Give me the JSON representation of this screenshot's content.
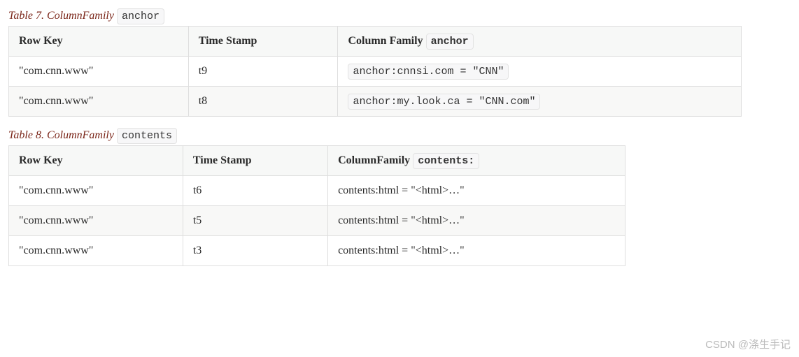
{
  "table7": {
    "caption_prefix": "Table 7. ColumnFamily ",
    "caption_code": "anchor",
    "headers": {
      "col1": "Row Key",
      "col2": "Time Stamp",
      "col3_prefix": "Column Family ",
      "col3_code": "anchor"
    },
    "rows": [
      {
        "rowkey": "\"com.cnn.www\"",
        "ts": "t9",
        "cf_code": "anchor:cnnsi.com = \"CNN\""
      },
      {
        "rowkey": "\"com.cnn.www\"",
        "ts": "t8",
        "cf_code": "anchor:my.look.ca = \"CNN.com\""
      }
    ]
  },
  "table8": {
    "caption_prefix": "Table 8. ColumnFamily ",
    "caption_code": "contents",
    "headers": {
      "col1": "Row Key",
      "col2": "Time Stamp",
      "col3_prefix": "ColumnFamily ",
      "col3_code": "contents:"
    },
    "rows": [
      {
        "rowkey": "\"com.cnn.www\"",
        "ts": "t6",
        "cf": "contents:html = \"<html>…\""
      },
      {
        "rowkey": "\"com.cnn.www\"",
        "ts": "t5",
        "cf": "contents:html = \"<html>…\""
      },
      {
        "rowkey": "\"com.cnn.www\"",
        "ts": "t3",
        "cf": "contents:html = \"<html>…\""
      }
    ]
  },
  "watermark": "CSDN @涤生手记"
}
